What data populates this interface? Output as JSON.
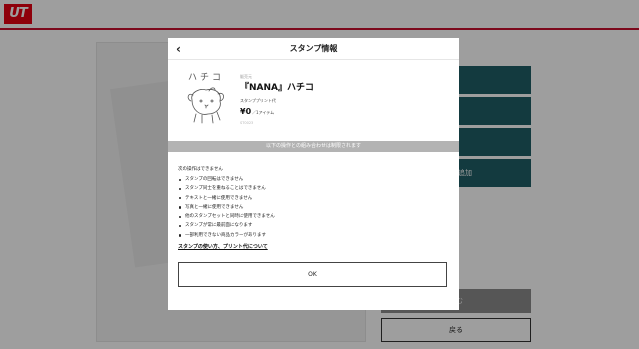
{
  "header": {
    "logo_text": "UT"
  },
  "background": {
    "side_buttons": [
      {
        "label": ""
      },
      {
        "label": ""
      },
      {
        "label": "加"
      },
      {
        "label": "を追加"
      }
    ],
    "gray_button_label": "進む",
    "back_button_label": "戻る"
  },
  "modal": {
    "title": "スタンプ情報",
    "back_icon": "chevron-left-icon",
    "stamp": {
      "caption": "ハチコ",
      "brand_label": "販売元",
      "name": "『NANA』ハチコ",
      "fee_label": "スタンププリント代",
      "price": "¥0",
      "price_unit": "／1アイテム",
      "code": "ST0023"
    },
    "restriction_bar": "以下の操作との組み合わせは制限されます",
    "restriction_intro": "次の操作はできません",
    "restrictions": [
      "スタンプの回転はできません",
      "スタンプ同士を重ねることはできません",
      "テキストと一緒に使用できません",
      "写真と一緒に使用できません",
      "他のスタンプセットと同時に使用できません",
      "スタンプが常に最前面になります",
      "一部利用できない商品カラーがあります"
    ],
    "usage_link": "スタンプの使い方、プリント代について",
    "ok_label": "OK"
  },
  "colors": {
    "brand": "#e60012",
    "header_rule": "#c8102e",
    "teal_button": "#1f5e66",
    "restriction_bar": "#b3b3b3"
  }
}
